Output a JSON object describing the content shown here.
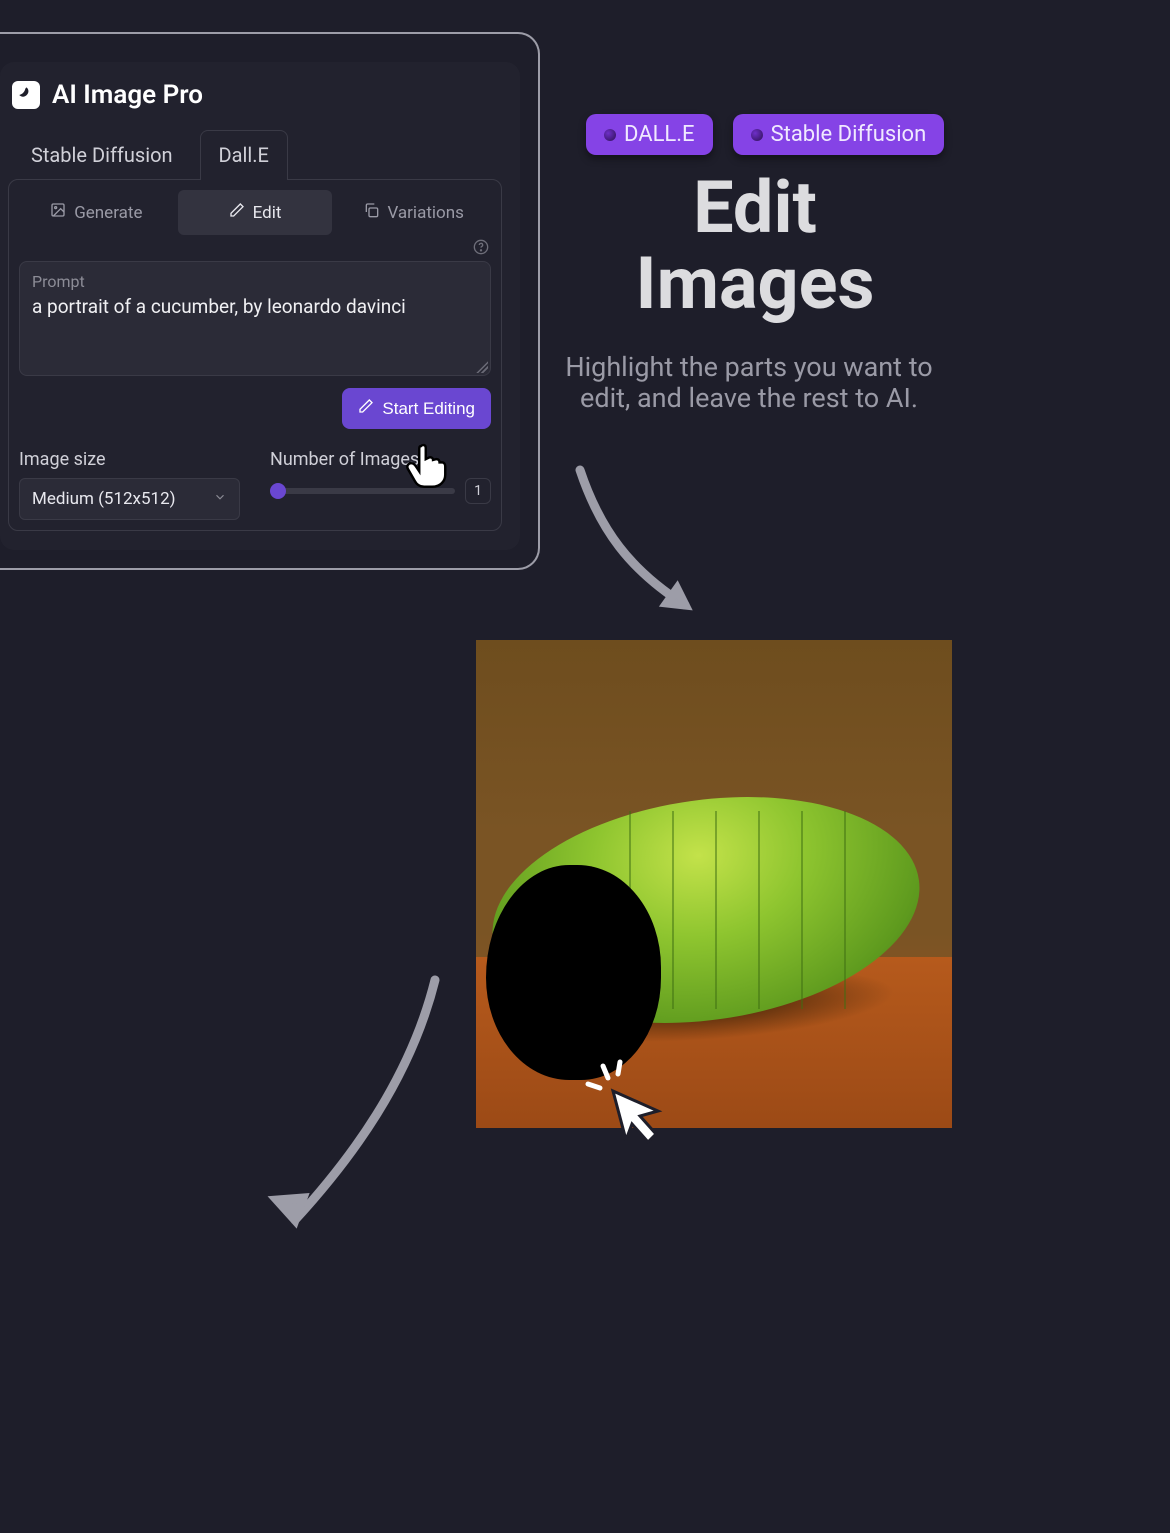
{
  "app": {
    "title": "AI Image Pro",
    "modelTabs": [
      "Stable Diffusion",
      "Dall.E"
    ],
    "activeModelTab": 1,
    "modeTabs": [
      {
        "label": "Generate",
        "icon": "image-icon"
      },
      {
        "label": "Edit",
        "icon": "pencil-icon"
      },
      {
        "label": "Variations",
        "icon": "copy-icon"
      }
    ],
    "activeModeTab": 1,
    "prompt": {
      "label": "Prompt",
      "value": "a portrait of a cucumber, by leonardo davinci"
    },
    "startButton": "Start Editing",
    "imageSize": {
      "label": "Image size",
      "selected": "Medium (512x512)"
    },
    "numImages": {
      "label": "Number of Images",
      "value": "1"
    }
  },
  "marketing": {
    "badges": [
      "DALL.E",
      "Stable Diffusion"
    ],
    "title": "Edit Images",
    "subtitle": "Highlight the parts you want to edit, and leave the rest to AI."
  },
  "colors": {
    "accent": "#6a47d1",
    "badge": "#8543e6",
    "panel": "#22222e",
    "bg": "#1e1e2a"
  }
}
